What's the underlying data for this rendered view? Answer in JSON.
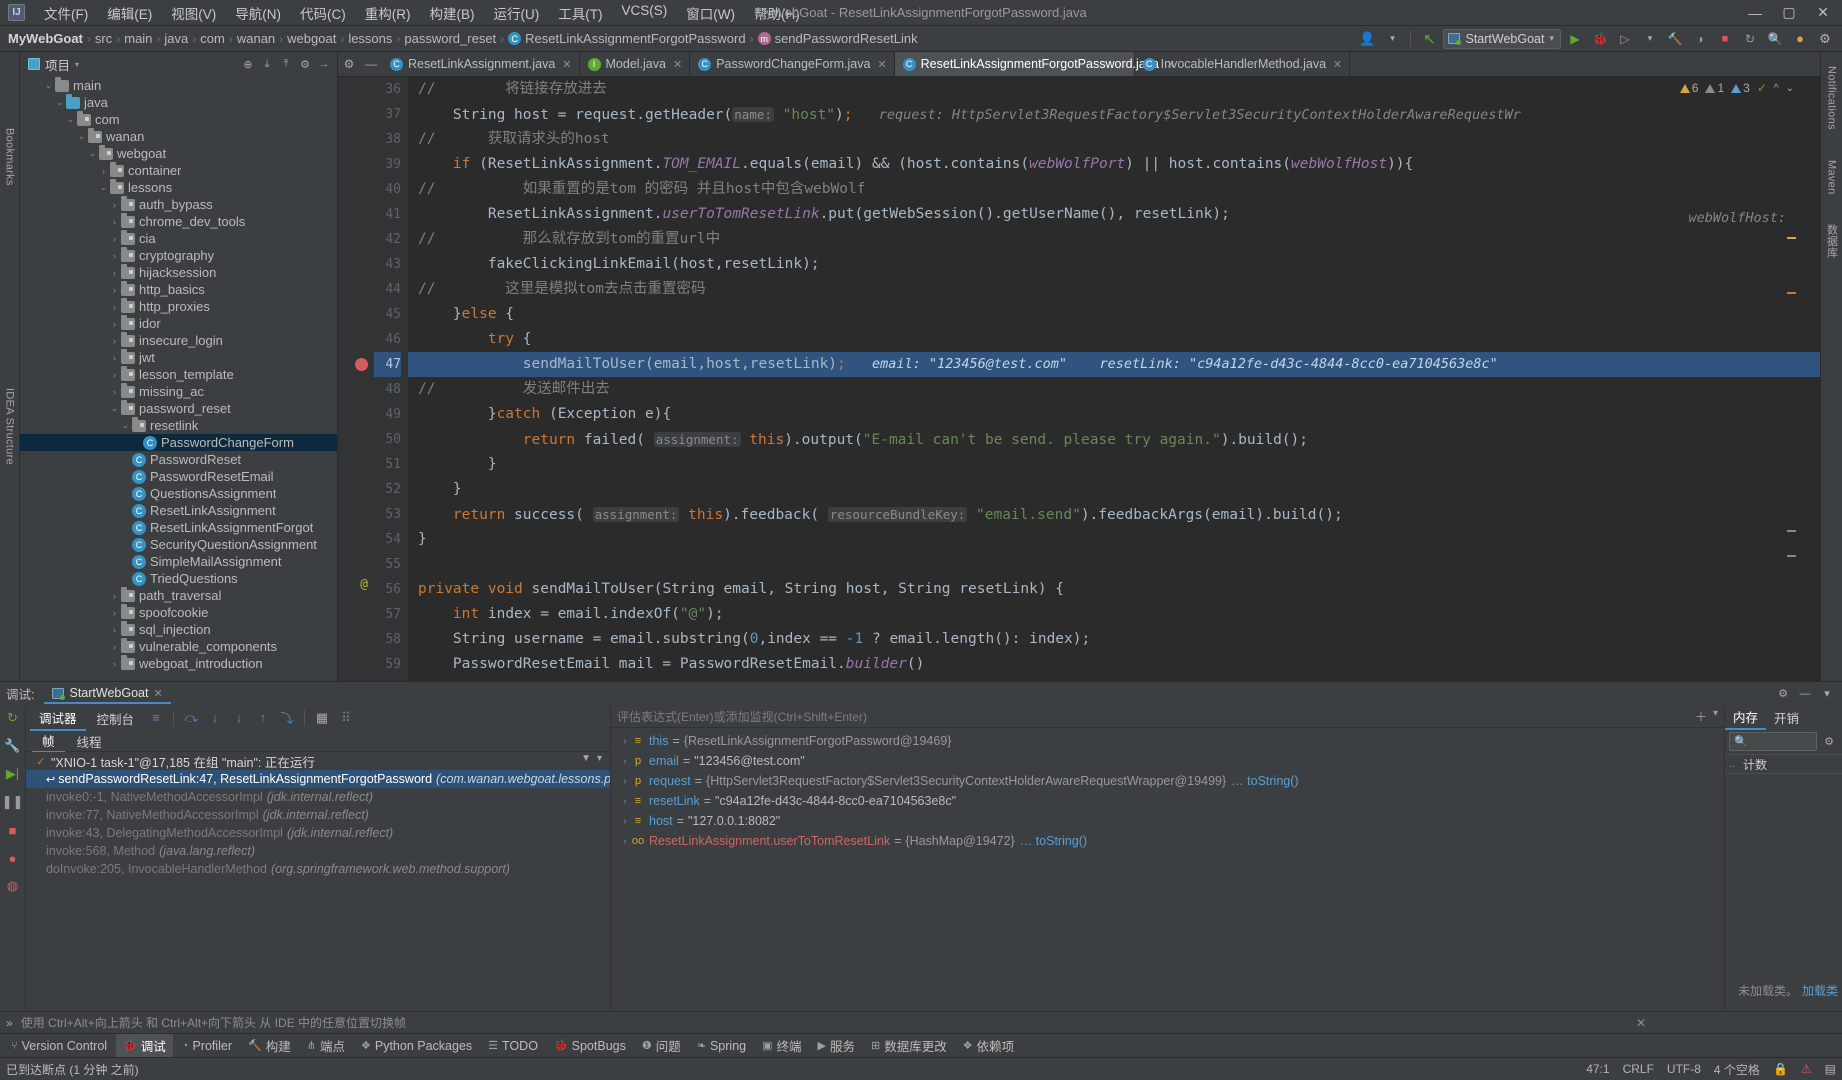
{
  "window": {
    "title": "MyWebGoat - ResetLinkAssignmentForgotPassword.java",
    "minimize": "—",
    "maximize": "▢",
    "close": "✕"
  },
  "menu": [
    {
      "label": "文件(F)"
    },
    {
      "label": "编辑(E)"
    },
    {
      "label": "视图(V)"
    },
    {
      "label": "导航(N)"
    },
    {
      "label": "代码(C)"
    },
    {
      "label": "重构(R)"
    },
    {
      "label": "构建(B)"
    },
    {
      "label": "运行(U)"
    },
    {
      "label": "工具(T)"
    },
    {
      "label": "VCS(S)"
    },
    {
      "label": "窗口(W)"
    },
    {
      "label": "帮助(H)"
    }
  ],
  "breadcrumb": {
    "sep": "›",
    "items": [
      {
        "label": "MyWebGoat",
        "icon": ""
      },
      {
        "label": "src",
        "icon": ""
      },
      {
        "label": "main",
        "icon": ""
      },
      {
        "label": "java",
        "icon": ""
      },
      {
        "label": "com",
        "icon": ""
      },
      {
        "label": "wanan",
        "icon": ""
      },
      {
        "label": "webgoat",
        "icon": ""
      },
      {
        "label": "lessons",
        "icon": ""
      },
      {
        "label": "password_reset",
        "icon": ""
      },
      {
        "label": "ResetLinkAssignmentForgotPassword",
        "icon": "class-icon",
        "glyph": "C"
      },
      {
        "label": "sendPasswordResetLink",
        "icon": "method-icon",
        "glyph": "m"
      }
    ]
  },
  "toolbar": {
    "run_config": "StartWebGoat",
    "dropdown_caret": "▾",
    "run_icon": "▶",
    "debug_icon": "🐞",
    "run_coverage_icon": "▷",
    "profiler_icon": "◑",
    "build_icon": "🔨",
    "stop_icon": "■",
    "search_icon": "🔍",
    "settings_icon": "⚙",
    "update_icon": "↻",
    "user_icon": "👤",
    "hide_icon": "↖"
  },
  "project_panel": {
    "title": "项目",
    "caret": "▾",
    "icons": [
      "locate-icon",
      "collapse-all-icon",
      "expand-all-icon",
      "settings-icon",
      "hide-icon"
    ],
    "tree": [
      {
        "indent": 2,
        "arrow": "v",
        "type": "folder",
        "label": "main"
      },
      {
        "indent": 3,
        "arrow": "v",
        "type": "folder-src",
        "label": "java"
      },
      {
        "indent": 4,
        "arrow": "v",
        "type": "folder-pkg",
        "label": "com"
      },
      {
        "indent": 5,
        "arrow": "v",
        "type": "folder-pkg",
        "label": "wanan"
      },
      {
        "indent": 6,
        "arrow": "v",
        "type": "folder-pkg",
        "label": "webgoat"
      },
      {
        "indent": 7,
        "arrow": ">",
        "type": "folder-pkg",
        "label": "container"
      },
      {
        "indent": 7,
        "arrow": "v",
        "type": "folder-pkg",
        "label": "lessons"
      },
      {
        "indent": 8,
        "arrow": ">",
        "type": "folder-pkg",
        "label": "auth_bypass"
      },
      {
        "indent": 8,
        "arrow": ">",
        "type": "folder-pkg",
        "label": "chrome_dev_tools"
      },
      {
        "indent": 8,
        "arrow": ">",
        "type": "folder-pkg",
        "label": "cia"
      },
      {
        "indent": 8,
        "arrow": ">",
        "type": "folder-pkg",
        "label": "cryptography"
      },
      {
        "indent": 8,
        "arrow": ">",
        "type": "folder-pkg",
        "label": "hijacksession"
      },
      {
        "indent": 8,
        "arrow": ">",
        "type": "folder-pkg",
        "label": "http_basics"
      },
      {
        "indent": 8,
        "arrow": ">",
        "type": "folder-pkg",
        "label": "http_proxies"
      },
      {
        "indent": 8,
        "arrow": ">",
        "type": "folder-pkg",
        "label": "idor"
      },
      {
        "indent": 8,
        "arrow": ">",
        "type": "folder-pkg",
        "label": "insecure_login"
      },
      {
        "indent": 8,
        "arrow": ">",
        "type": "folder-pkg",
        "label": "jwt"
      },
      {
        "indent": 8,
        "arrow": ">",
        "type": "folder-pkg",
        "label": "lesson_template"
      },
      {
        "indent": 8,
        "arrow": ">",
        "type": "folder-pkg",
        "label": "missing_ac"
      },
      {
        "indent": 8,
        "arrow": "v",
        "type": "folder-pkg",
        "label": "password_reset"
      },
      {
        "indent": 9,
        "arrow": "v",
        "type": "folder-pkg",
        "label": "resetlink"
      },
      {
        "indent": 10,
        "arrow": "",
        "type": "class",
        "label": "PasswordChangeForm",
        "selected": true
      },
      {
        "indent": 9,
        "arrow": "",
        "type": "class",
        "label": "PasswordReset"
      },
      {
        "indent": 9,
        "arrow": "",
        "type": "class",
        "label": "PasswordResetEmail"
      },
      {
        "indent": 9,
        "arrow": "",
        "type": "class",
        "label": "QuestionsAssignment"
      },
      {
        "indent": 9,
        "arrow": "",
        "type": "class",
        "label": "ResetLinkAssignment"
      },
      {
        "indent": 9,
        "arrow": "",
        "type": "class",
        "label": "ResetLinkAssignmentForgot"
      },
      {
        "indent": 9,
        "arrow": "",
        "type": "class",
        "label": "SecurityQuestionAssignment"
      },
      {
        "indent": 9,
        "arrow": "",
        "type": "class",
        "label": "SimpleMailAssignment"
      },
      {
        "indent": 9,
        "arrow": "",
        "type": "class",
        "label": "TriedQuestions"
      },
      {
        "indent": 8,
        "arrow": ">",
        "type": "folder-pkg",
        "label": "path_traversal"
      },
      {
        "indent": 8,
        "arrow": ">",
        "type": "folder-pkg",
        "label": "spoofcookie"
      },
      {
        "indent": 8,
        "arrow": ">",
        "type": "folder-pkg",
        "label": "sql_injection"
      },
      {
        "indent": 8,
        "arrow": ">",
        "type": "folder-pkg",
        "label": "vulnerable_components"
      },
      {
        "indent": 8,
        "arrow": ">",
        "type": "folder-pkg",
        "label": "webgoat_introduction"
      }
    ]
  },
  "editor_tabs": [
    {
      "label": "ResetLinkAssignment.java",
      "icon": "class-icon",
      "glyph": "C",
      "active": false
    },
    {
      "label": "Model.java",
      "icon": "interface-icon",
      "glyph": "I",
      "active": false
    },
    {
      "label": "PasswordChangeForm.java",
      "icon": "class-icon",
      "glyph": "C",
      "active": false
    },
    {
      "label": "ResetLinkAssignmentForgotPassword.java",
      "icon": "class-icon",
      "glyph": "C",
      "active": true
    },
    {
      "label": "InvocableHandlerMethod.java",
      "icon": "class-icon",
      "glyph": "C",
      "active": false
    }
  ],
  "inspection_widget": {
    "warnings": "6",
    "weak_warnings": "1",
    "typos": "3",
    "ok_check": "✓",
    "caret_up": "^",
    "caret_down": "⌄"
  },
  "code": {
    "first_line": 36,
    "highlight_line": 47,
    "lines": [
      {
        "n": 36,
        "html": "<span class=\"cmt\">//        将链接存放进去</span>"
      },
      {
        "n": 37,
        "html": "<span class=\"plain\">    String host = request.getHeader(</span><span class=\"hint\">name:</span> <span class=\"str\">\"host\"</span><span class=\"plain\">)</span><span class=\"kw\">;</span>   <span class=\"inl\">request: HttpServlet3RequestFactory$Servlet3SecurityContextHolderAwareRequestWr</span>"
      },
      {
        "n": 38,
        "html": "<span class=\"cmt\">//      获取请求头的host</span>"
      },
      {
        "n": 39,
        "html": "<span class=\"plain\">    </span><span class=\"kw\">if</span><span class=\"plain\"> (ResetLinkAssignment.</span><span class=\"fld\">TOM_EMAIL</span><span class=\"plain\">.equals(email) &amp;&amp; (host.contains(</span><span class=\"fld\">webWolfPort</span><span class=\"plain\">) || host.contains(</span><span class=\"fld\">webWolfHost</span><span class=\"plain\">)){</span>"
      },
      {
        "n": 40,
        "html": "<span class=\"cmt\">//          如果重置的是tom 的密码 并且host中包含webWolf</span>"
      },
      {
        "n": 41,
        "html": "<span class=\"plain\">        ResetLinkAssignment.</span><span class=\"fld\">userToTomResetLink</span><span class=\"plain\">.put(getWebSession().getUserName(), resetLink);</span>"
      },
      {
        "n": 42,
        "html": "<span class=\"cmt\">//          那么就存放到tom的重置url中</span>"
      },
      {
        "n": 43,
        "html": "<span class=\"plain\">        fakeClickingLinkEmail(host,resetLink);</span>"
      },
      {
        "n": 44,
        "html": "<span class=\"cmt\">//        这里是模拟tom去点击重置密码</span>"
      },
      {
        "n": 45,
        "html": "<span class=\"plain\">    }</span><span class=\"kw\">else</span><span class=\"plain\"> {</span>"
      },
      {
        "n": 46,
        "html": "<span class=\"plain\">        </span><span class=\"kw\">try</span><span class=\"plain\"> {</span>"
      },
      {
        "n": 47,
        "html": "<span class=\"plain\">            sendMailToUser(email,host,resetLink)</span><span class=\"kw\">;</span>   <span class=\"inl-hl\">email: \"123456@test.com\"    resetLink: \"c94a12fe-d43c-4844-8cc0-ea7104563e8c\"</span>",
        "highlight": true,
        "breakpoint": true
      },
      {
        "n": 48,
        "html": "<span class=\"cmt\">//          发送邮件出去</span>"
      },
      {
        "n": 49,
        "html": "<span class=\"plain\">        }</span><span class=\"kw\">catch</span><span class=\"plain\"> (Exception e){</span>"
      },
      {
        "n": 50,
        "html": "<span class=\"plain\">            </span><span class=\"kw\">return</span><span class=\"plain\"> failed( </span><span class=\"hint\">assignment:</span><span class=\"plain\"> </span><span class=\"kw\">this</span><span class=\"plain\">).output(</span><span class=\"str\">\"E-mail can't be send. please try again.\"</span><span class=\"plain\">).build();</span>"
      },
      {
        "n": 51,
        "html": "<span class=\"plain\">        }</span>"
      },
      {
        "n": 52,
        "html": "<span class=\"plain\">    }</span>"
      },
      {
        "n": 53,
        "html": "<span class=\"plain\">    </span><span class=\"kw\">return</span><span class=\"plain\"> success( </span><span class=\"hint\">assignment:</span><span class=\"plain\"> </span><span class=\"kw\">this</span><span class=\"plain\">).feedback( </span><span class=\"hint\">resourceBundleKey:</span><span class=\"plain\"> </span><span class=\"str\">\"email.send\"</span><span class=\"plain\">).feedbackArgs(email).build();</span>"
      },
      {
        "n": 54,
        "html": "<span class=\"plain\">}</span>"
      },
      {
        "n": 55,
        "html": ""
      },
      {
        "n": 56,
        "html": "<span class=\"kw\">private void</span><span class=\"plain\"> </span><span class=\"plain\">sendMailToUser(String email, String host, String resetLink) {</span>",
        "annot": "@"
      },
      {
        "n": 57,
        "html": "<span class=\"plain\">    </span><span class=\"kw\">int</span><span class=\"plain\"> index = email.indexOf(</span><span class=\"str\">\"@\"</span><span class=\"plain\">);</span>"
      },
      {
        "n": 58,
        "html": "<span class=\"plain\">    String username = email.substring(</span><span class=\"num-lit\">0</span><span class=\"plain\">,index == </span><span class=\"num-lit\">-1</span><span class=\"plain\"> ? email.length(): index);</span>"
      },
      {
        "n": 59,
        "html": "<span class=\"plain\">    PasswordResetEmail mail = PasswordResetEmail.</span><span class=\"fld\">builder</span><span class=\"plain\">()</span>"
      }
    ],
    "right_gutter_hint": "webWolfHost:"
  },
  "right_rail": [
    {
      "label": "Notifications",
      "icon": "bell-icon"
    },
    {
      "label": "Maven",
      "icon": "m-icon"
    },
    {
      "label": "数据库",
      "icon": "db-icon"
    }
  ],
  "left_rail": [
    {
      "label": "Bookmarks",
      "icon": "bookmark-icon"
    },
    {
      "label": "IDEA Structure",
      "icon": "structure-icon"
    }
  ],
  "debug": {
    "label": "调试:",
    "session_tab": "StartWebGoat",
    "close_x": "✕",
    "header_icons": [
      "settings-icon",
      "minimize-icon",
      "hide-icon"
    ],
    "tabs": [
      {
        "label": "调试器",
        "active": true
      },
      {
        "label": "控制台",
        "active": false
      }
    ],
    "step_icons": [
      {
        "name": "show-execution-point-icon",
        "glyph": "≡",
        "color": "#4a88c7"
      },
      {
        "name": "step-over-icon",
        "glyph": "⤼",
        "color": "#4a88c7"
      },
      {
        "name": "step-into-icon",
        "glyph": "↓",
        "color": "#4a88c7"
      },
      {
        "name": "force-step-into-icon",
        "glyph": "↓",
        "color": "#db5860"
      },
      {
        "name": "step-out-icon",
        "glyph": "↑",
        "color": "#4a88c7"
      },
      {
        "name": "run-to-cursor-icon",
        "glyph": "⤵",
        "color": "#4a88c7"
      },
      {
        "name": "evaluate-expression-icon",
        "glyph": "▦",
        "color": "#a8a8a8"
      },
      {
        "name": "layout-settings-icon",
        "glyph": "⠿",
        "color": "#7a7a7a"
      }
    ],
    "side_icons": [
      {
        "name": "rerun-icon",
        "glyph": "↻",
        "color": "#5fa832"
      },
      {
        "name": "settings-wrench-icon",
        "glyph": "🔧",
        "color": "#9a9a9a"
      },
      {
        "name": "resume-icon",
        "glyph": "▶|",
        "color": "#5fa832"
      },
      {
        "name": "pause-icon",
        "glyph": "❚❚",
        "color": "#9a9a9a"
      },
      {
        "name": "stop-icon",
        "glyph": "■",
        "color": "#db5860"
      },
      {
        "name": "view-breakpoints-icon",
        "glyph": "●",
        "color": "#db5860"
      },
      {
        "name": "mute-breakpoints-icon",
        "glyph": "◍",
        "color": "#db5860"
      }
    ],
    "frame_tabs": [
      {
        "label": "帧",
        "active": true
      },
      {
        "label": "线程",
        "active": false
      }
    ],
    "thread": {
      "check": "✓",
      "text": "\"XNIO-1 task-1\"@17,185 在组 \"main\": 正在运行"
    },
    "frames": [
      {
        "name": "sendPasswordResetLink:47, ResetLinkAssignmentForgotPassword",
        "pkg": "(com.wanan.webgoat.lessons.password_rese",
        "selected": true,
        "icon": "↩"
      },
      {
        "name": "invoke0:-1, NativeMethodAccessorImpl",
        "pkg": "(jdk.internal.reflect)",
        "selected": false,
        "icon": ""
      },
      {
        "name": "invoke:77, NativeMethodAccessorImpl",
        "pkg": "(jdk.internal.reflect)",
        "selected": false,
        "icon": ""
      },
      {
        "name": "invoke:43, DelegatingMethodAccessorImpl",
        "pkg": "(jdk.internal.reflect)",
        "selected": false,
        "icon": ""
      },
      {
        "name": "invoke:568, Method",
        "pkg": "(java.lang.reflect)",
        "selected": false,
        "icon": ""
      },
      {
        "name": "doInvoke:205, InvocableHandlerMethod",
        "pkg": "(org.springframework.web.method.support)",
        "selected": false,
        "icon": ""
      }
    ],
    "filter_icon": "▼",
    "evaluate_placeholder": "评估表达式(Enter)或添加监视(Ctrl+Shift+Enter)",
    "add_watch_icon": "＋",
    "watch_caret": "▾",
    "variables": [
      {
        "arrow": "›",
        "kind": "local",
        "name": "this",
        "value": "{ResetLinkAssignmentForgotPassword@19469}",
        "link": "",
        "type": "obj"
      },
      {
        "arrow": "›",
        "kind": "param",
        "name": "email",
        "value": "\"123456@test.com\"",
        "link": "",
        "type": "str"
      },
      {
        "arrow": "›",
        "kind": "param",
        "name": "request",
        "value": "{HttpServlet3RequestFactory$Servlet3SecurityContextHolderAwareRequestWrapper@19499}",
        "link": "… toString()",
        "type": "obj"
      },
      {
        "arrow": "›",
        "kind": "local",
        "name": "resetLink",
        "value": "\"c94a12fe-d43c-4844-8cc0-ea7104563e8c\"",
        "link": "",
        "type": "str"
      },
      {
        "arrow": "›",
        "kind": "local",
        "name": "host",
        "value": "\"127.0.0.1:8082\"",
        "link": "",
        "type": "str"
      },
      {
        "arrow": "›",
        "kind": "static",
        "name": "ResetLinkAssignment.userToTomResetLink",
        "value": "{HashMap@19472}",
        "link": "… toString()",
        "type": "obj"
      }
    ],
    "memory": {
      "tabs": [
        {
          "label": "内存",
          "active": true
        },
        {
          "label": "开销",
          "active": false
        }
      ],
      "search_icon": "🔍",
      "settings_icon": "⚙",
      "column": "计数",
      "empty_text": "未加载类。",
      "load_link": "加载类"
    },
    "tip": {
      "chevrons": "»",
      "text": "使用 Ctrl+Alt+向上箭头 和 Ctrl+Alt+向下箭头 从 IDE 中的任意位置切换帧",
      "close": "✕"
    }
  },
  "tool_windows": [
    {
      "label": "Version Control",
      "icon": "branch-icon",
      "active": false
    },
    {
      "label": "调试",
      "icon": "debug-icon",
      "active": true
    },
    {
      "label": "Profiler",
      "icon": "profiler-icon",
      "active": false
    },
    {
      "label": "构建",
      "icon": "build-icon",
      "active": false
    },
    {
      "label": "端点",
      "icon": "endpoints-icon",
      "active": false
    },
    {
      "label": "Python Packages",
      "icon": "packages-icon",
      "active": false
    },
    {
      "label": "TODO",
      "icon": "todo-icon",
      "active": false
    },
    {
      "label": "SpotBugs",
      "icon": "spotbugs-icon",
      "active": false
    },
    {
      "label": "问题",
      "icon": "problems-icon",
      "active": false
    },
    {
      "label": "Spring",
      "icon": "spring-icon",
      "active": false
    },
    {
      "label": "终端",
      "icon": "terminal-icon",
      "active": false
    },
    {
      "label": "服务",
      "icon": "services-icon",
      "active": false
    },
    {
      "label": "数据库更改",
      "icon": "db-changes-icon",
      "active": false
    },
    {
      "label": "依赖项",
      "icon": "dependencies-icon",
      "active": false
    }
  ],
  "status_bar": {
    "message": "已到达断点 (1 分钟 之前)",
    "caret_position": "47:1",
    "line_separator": "CRLF",
    "encoding": "UTF-8",
    "indent": "4 个空格",
    "lock_icon": "🔒",
    "warning_icon": "⚠",
    "layout_icon": "▤"
  }
}
